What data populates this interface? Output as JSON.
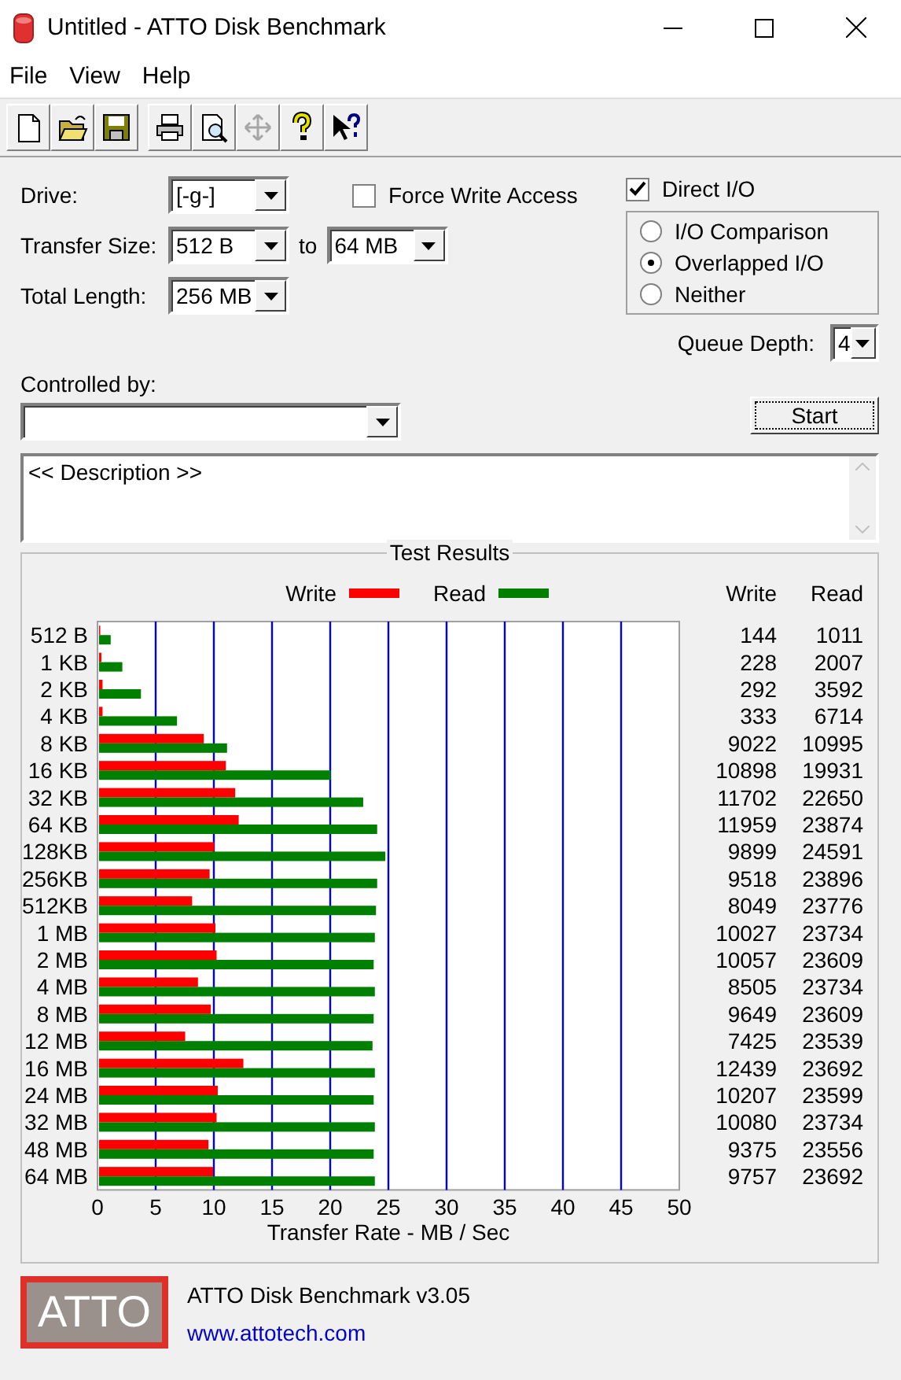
{
  "window": {
    "title": "Untitled - ATTO Disk Benchmark"
  },
  "menu": [
    "File",
    "View",
    "Help"
  ],
  "toolbar": [
    [
      {
        "kind": "new",
        "disabled": false
      },
      {
        "kind": "open",
        "disabled": false
      },
      {
        "kind": "save",
        "disabled": false
      }
    ],
    [
      {
        "kind": "print",
        "disabled": false
      },
      {
        "kind": "preview",
        "disabled": false
      },
      {
        "kind": "move",
        "disabled": true
      },
      {
        "kind": "help",
        "disabled": false
      },
      {
        "kind": "context_help",
        "disabled": false
      }
    ]
  ],
  "settings": {
    "drive": {
      "label": "Drive:",
      "value": "[-g-]"
    },
    "transfer_size": {
      "label": "Transfer Size:",
      "from": "512 B",
      "to_label": "to",
      "to": "64 MB"
    },
    "total_length": {
      "label": "Total Length:",
      "value": "256 MB"
    },
    "force_write_access": {
      "label": "Force Write Access",
      "checked": false
    },
    "direct_io": {
      "label": "Direct I/O",
      "checked": true
    },
    "io_mode": [
      {
        "label": "I/O Comparison",
        "selected": false
      },
      {
        "label": "Overlapped I/O",
        "selected": true
      },
      {
        "label": "Neither",
        "selected": false
      }
    ],
    "queue_depth": {
      "label": "Queue Depth:",
      "value": "4"
    },
    "controlled_by": {
      "label": "Controlled by:"
    },
    "start_button": "Start",
    "description": "<< Description >>"
  },
  "test_results": {
    "title": "Test Results",
    "columns": [
      "Write",
      "Read"
    ],
    "rows": [
      {
        "write": "144",
        "read": "1011"
      },
      {
        "write": "228",
        "read": "2007"
      },
      {
        "write": "292",
        "read": "3592"
      },
      {
        "write": "333",
        "read": "6714"
      },
      {
        "write": "9022",
        "read": "10995"
      },
      {
        "write": "10898",
        "read": "19931"
      },
      {
        "write": "11702",
        "read": "22650"
      },
      {
        "write": "11959",
        "read": "23874"
      },
      {
        "write": "9899",
        "read": "24591"
      },
      {
        "write": "9518",
        "read": "23896"
      },
      {
        "write": "8049",
        "read": "23776"
      },
      {
        "write": "10027",
        "read": "23734"
      },
      {
        "write": "10057",
        "read": "23609"
      },
      {
        "write": "8505",
        "read": "23734"
      },
      {
        "write": "9649",
        "read": "23609"
      },
      {
        "write": "7425",
        "read": "23539"
      },
      {
        "write": "12439",
        "read": "23692"
      },
      {
        "write": "10207",
        "read": "23599"
      },
      {
        "write": "10080",
        "read": "23734"
      },
      {
        "write": "9375",
        "read": "23556"
      },
      {
        "write": "9757",
        "read": "23692"
      }
    ],
    "chart_data": {
      "type": "bar",
      "orientation": "horizontal",
      "xlabel": "Transfer Rate - MB / Sec",
      "categories": [
        "512 B",
        "1 KB",
        "2 KB",
        "4 KB",
        "8 KB",
        "16 KB",
        "32 KB",
        "64 KB",
        "128KB",
        "256KB",
        "512KB",
        "1 MB",
        "2 MB",
        "4 MB",
        "8 MB",
        "12 MB",
        "16 MB",
        "24 MB",
        "32 MB",
        "48 MB",
        "64 MB"
      ],
      "series": [
        {
          "name": "Write",
          "color": "#ff0000",
          "values": [
            0.1,
            0.2,
            0.3,
            0.3,
            9.0,
            10.9,
            11.7,
            12.0,
            9.9,
            9.5,
            8.0,
            10.0,
            10.1,
            8.5,
            9.6,
            7.4,
            12.4,
            10.2,
            10.1,
            9.4,
            9.8
          ]
        },
        {
          "name": "Read",
          "color": "#008000",
          "values": [
            1.0,
            2.0,
            3.6,
            6.7,
            11.0,
            19.9,
            22.7,
            23.9,
            24.6,
            23.9,
            23.8,
            23.7,
            23.6,
            23.7,
            23.6,
            23.5,
            23.7,
            23.6,
            23.7,
            23.6,
            23.7
          ]
        }
      ],
      "xlim": [
        0,
        50
      ],
      "xticks": [
        0,
        5,
        10,
        15,
        20,
        25,
        30,
        35,
        40,
        45,
        50
      ],
      "grid": true,
      "legend": true
    }
  },
  "footer": {
    "logo": "ATTO",
    "version": "ATTO Disk Benchmark v3.05",
    "link": "www.attotech.com"
  }
}
